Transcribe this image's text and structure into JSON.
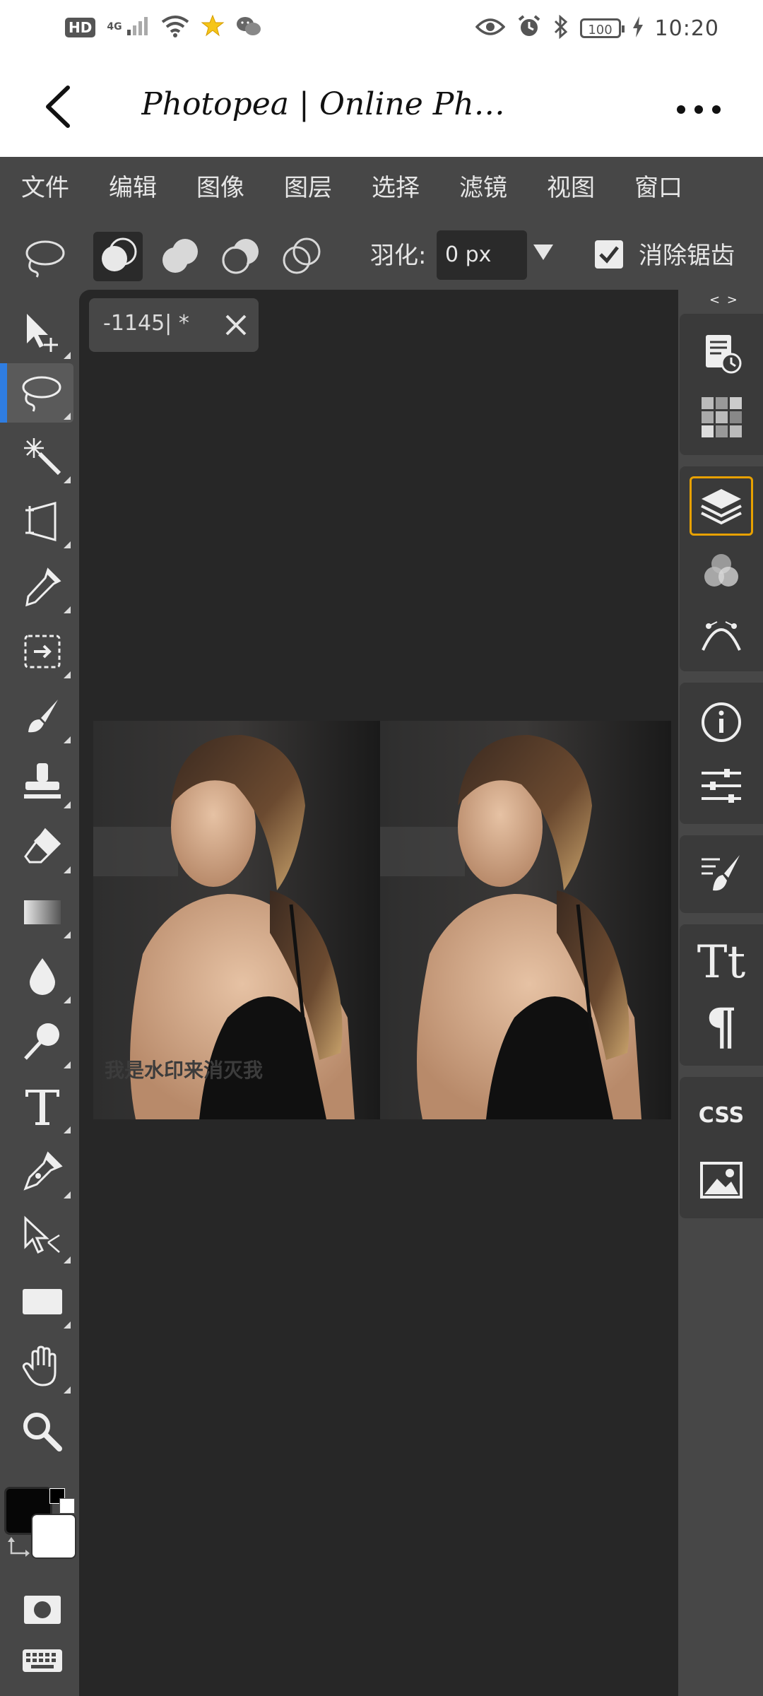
{
  "status_bar": {
    "hd_label": "HD",
    "network_label": "4G",
    "time": "10:20",
    "battery_level": "100",
    "icons": [
      "signal-icon",
      "wifi-icon",
      "star-app-icon",
      "wechat-icon",
      "eye-icon",
      "alarm-icon",
      "bluetooth-icon",
      "battery-icon",
      "charging-icon"
    ]
  },
  "browser": {
    "title": "Photopea | Online Ph…",
    "back_icon": "chevron-left-icon",
    "more_icon": "more-dots-icon"
  },
  "menu": {
    "items": [
      "文件",
      "编辑",
      "图像",
      "图层",
      "选择",
      "滤镜",
      "视图",
      "窗口"
    ]
  },
  "options": {
    "tool_icon": "lasso-icon",
    "selection_modes": [
      "new-selection",
      "add-to-selection",
      "subtract-from-selection",
      "intersect-selection"
    ],
    "active_mode": "new-selection",
    "feather_label": "羽化:",
    "feather_value": "0 px",
    "antialias_label": "消除锯齿",
    "antialias_checked": true
  },
  "tools": {
    "items": [
      "move-tool",
      "lasso-tool",
      "magic-wand-tool",
      "crop-tool",
      "eyedropper-tool",
      "patch-tool",
      "brush-tool",
      "stamp-tool",
      "eraser-tool",
      "gradient-tool",
      "blur-tool",
      "dodge-tool",
      "type-tool",
      "pen-tool",
      "path-select-tool",
      "rectangle-tool",
      "hand-tool",
      "zoom-tool",
      "quick-mask",
      "keyboard"
    ],
    "active": "lasso-tool",
    "foreground_color": "#000000",
    "background_color": "#ffffff"
  },
  "document": {
    "tab_name": "-1145| *",
    "close_icon": "close-icon"
  },
  "canvas": {
    "watermark": "我是水印来消灭我"
  },
  "panels": {
    "groups": [
      [
        "history-panel",
        "swatches-panel"
      ],
      [
        "layers-panel",
        "channels-panel",
        "paths-panel"
      ],
      [
        "info-panel",
        "adjustments-panel"
      ],
      [
        "brush-settings-panel"
      ],
      [
        "character-panel",
        "paragraph-panel"
      ],
      [
        "css-panel",
        "image-panel"
      ]
    ],
    "selected": "layers-panel",
    "css_label": "CSS",
    "character_label": "Tt",
    "paragraph_label": "¶"
  },
  "colors": {
    "app_bg": "#474747",
    "canvas_bg": "#272727",
    "accent_blue": "#2f7de1",
    "accent_orange": "#e8a100"
  }
}
